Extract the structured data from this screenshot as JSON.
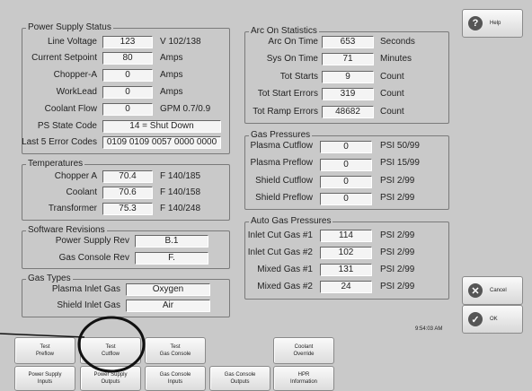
{
  "power_supply": {
    "title": "Power Supply Status",
    "line_voltage": {
      "label": "Line Voltage",
      "value": "123",
      "unit": "V 102/138"
    },
    "current_setpoint": {
      "label": "Current Setpoint",
      "value": "80",
      "unit": "Amps"
    },
    "chopper_a": {
      "label": "Chopper-A",
      "value": "0",
      "unit": "Amps"
    },
    "worklead": {
      "label": "WorkLead",
      "value": "0",
      "unit": "Amps"
    },
    "coolant_flow": {
      "label": "Coolant Flow",
      "value": "0",
      "unit": "GPM 0.7/0.9"
    },
    "ps_state": {
      "label": "PS State Code",
      "value": "14 = Shut Down"
    },
    "error_codes": {
      "label": "Last 5 Error Codes",
      "value": "0109 0109 0057 0000 0000"
    }
  },
  "temperatures": {
    "title": "Temperatures",
    "chopper_a": {
      "label": "Chopper A",
      "value": "70.4",
      "unit": "F 140/185"
    },
    "coolant": {
      "label": "Coolant",
      "value": "70.6",
      "unit": "F 140/158"
    },
    "transformer": {
      "label": "Transformer",
      "value": "75.3",
      "unit": "F 140/248"
    }
  },
  "software": {
    "title": "Software Revisions",
    "power_supply_rev": {
      "label": "Power Supply Rev",
      "value": "B.1"
    },
    "gas_console_rev": {
      "label": "Gas Console Rev",
      "value": "F."
    }
  },
  "gas_types": {
    "title": "Gas Types",
    "plasma_inlet": {
      "label": "Plasma Inlet Gas",
      "value": "Oxygen"
    },
    "shield_inlet": {
      "label": "Shield Inlet Gas",
      "value": "Air"
    }
  },
  "arc_on": {
    "title": "Arc On Statistics",
    "arc_on_time": {
      "label": "Arc On Time",
      "value": "653",
      "unit": "Seconds"
    },
    "sys_on_time": {
      "label": "Sys On Time",
      "value": "71",
      "unit": "Minutes"
    },
    "tot_starts": {
      "label": "Tot Starts",
      "value": "9",
      "unit": "Count"
    },
    "tot_start_errors": {
      "label": "Tot Start Errors",
      "value": "319",
      "unit": "Count"
    },
    "tot_ramp_errors": {
      "label": "Tot Ramp Errors",
      "value": "48682",
      "unit": "Count"
    }
  },
  "gas_pressures": {
    "title": "Gas Pressures",
    "plasma_cutflow": {
      "label": "Plasma Cutflow",
      "value": "0",
      "unit": "PSI 50/99"
    },
    "plasma_preflow": {
      "label": "Plasma Preflow",
      "value": "0",
      "unit": "PSI 15/99"
    },
    "shield_cutflow": {
      "label": "Shield Cutflow",
      "value": "0",
      "unit": "PSI 2/99"
    },
    "shield_preflow": {
      "label": "Shield Preflow",
      "value": "0",
      "unit": "PSI 2/99"
    }
  },
  "auto_gas": {
    "title": "Auto Gas Pressures",
    "inlet_cut_1": {
      "label": "Inlet Cut Gas #1",
      "value": "114",
      "unit": "PSI 2/99"
    },
    "inlet_cut_2": {
      "label": "Inlet Cut Gas #2",
      "value": "102",
      "unit": "PSI 2/99"
    },
    "mixed_1": {
      "label": "Mixed Gas #1",
      "value": "131",
      "unit": "PSI 2/99"
    },
    "mixed_2": {
      "label": "Mixed Gas #2",
      "value": "24",
      "unit": "PSI 2/99"
    }
  },
  "side": {
    "help": "Help",
    "cancel": "Cancel",
    "ok": "OK"
  },
  "time": "9:54:03 AM",
  "buttons": {
    "test_preflow": [
      "Test",
      "Preflow"
    ],
    "test_cutflow": [
      "Test",
      "Cutflow"
    ],
    "test_gas_console": [
      "Test",
      "Gas Console"
    ],
    "coolant_override": [
      "Coolant",
      "Override"
    ],
    "ps_inputs": [
      "Power Supply",
      "Inputs"
    ],
    "ps_outputs": [
      "Power Supply",
      "Outputs"
    ],
    "gc_inputs": [
      "Gas Console",
      "Inputs"
    ],
    "gc_outputs": [
      "Gas Console",
      "Outputs"
    ],
    "hpr_info": [
      "HPR",
      "Information"
    ]
  }
}
